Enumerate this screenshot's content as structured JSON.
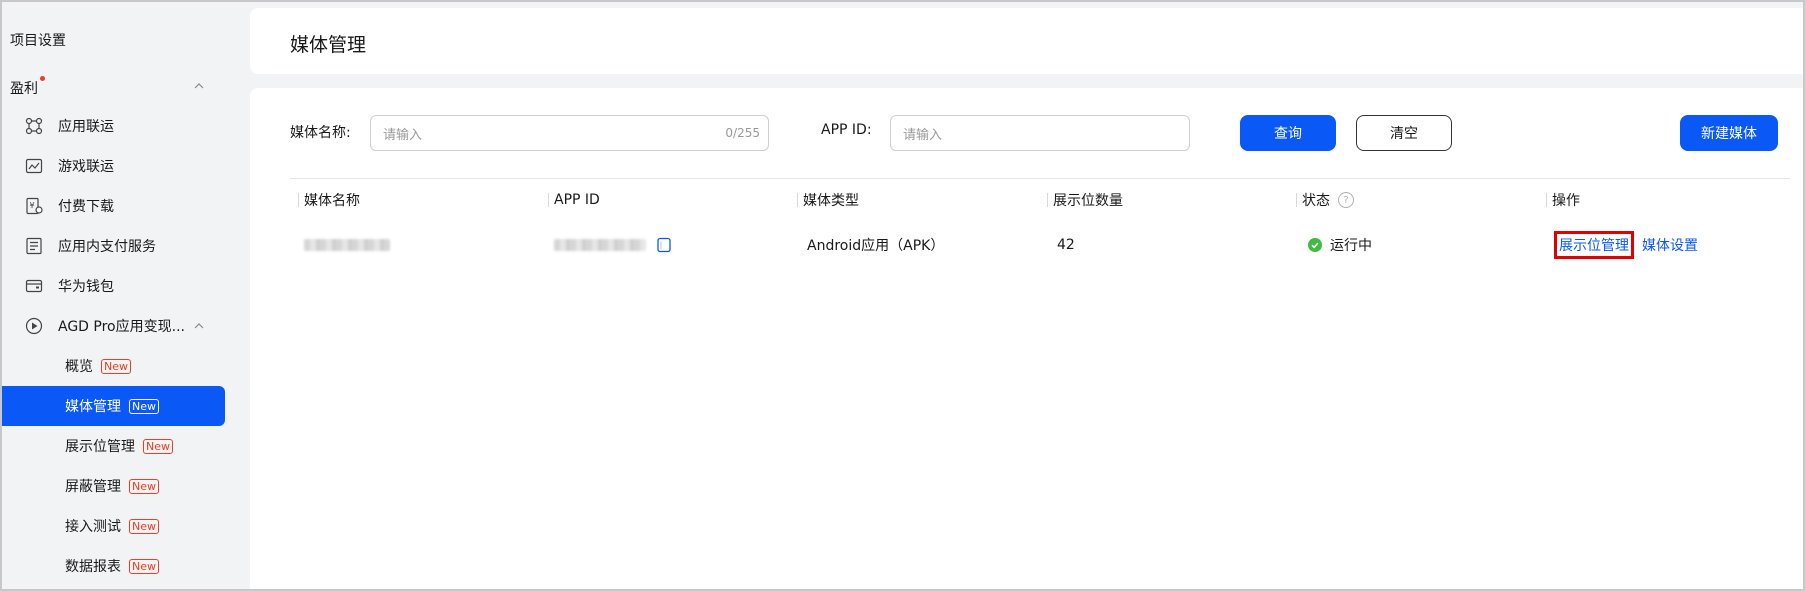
{
  "sidebar": {
    "title": "项目设置",
    "group": "盈利",
    "items": [
      {
        "label": "应用联运",
        "icon": "app-network-icon"
      },
      {
        "label": "游戏联运",
        "icon": "game-network-icon"
      },
      {
        "label": "付费下载",
        "icon": "paid-download-icon"
      },
      {
        "label": "应用内支付服务",
        "icon": "in-app-payment-icon"
      },
      {
        "label": "华为钱包",
        "icon": "wallet-icon"
      },
      {
        "label": "AGD Pro应用变现...",
        "icon": "play-circle-icon"
      }
    ],
    "subitems": [
      {
        "label": "概览",
        "badge": "New",
        "active": false
      },
      {
        "label": "媒体管理",
        "badge": "New",
        "active": true
      },
      {
        "label": "展示位管理",
        "badge": "New",
        "active": false
      },
      {
        "label": "屏蔽管理",
        "badge": "New",
        "active": false
      },
      {
        "label": "接入测试",
        "badge": "New",
        "active": false
      },
      {
        "label": "数据报表",
        "badge": "New",
        "active": false
      }
    ]
  },
  "header": {
    "title": "媒体管理"
  },
  "filters": {
    "media_name_label": "媒体名称:",
    "media_name_placeholder": "请输入",
    "media_name_counter": "0/255",
    "app_id_label": "APP ID:",
    "app_id_placeholder": "请输入",
    "query_button": "查询",
    "clear_button": "清空",
    "new_media_button": "新建媒体"
  },
  "table": {
    "columns": [
      "媒体名称",
      "APP ID",
      "媒体类型",
      "展示位数量",
      "状态",
      "操作"
    ],
    "rows": [
      {
        "media_type": "Android应用（APK）",
        "slot_count": "42",
        "status": "运行中",
        "actions": [
          "展示位管理",
          "媒体设置"
        ]
      }
    ]
  },
  "colors": {
    "accent": "#0a59f7",
    "badge": "#e84026",
    "status_ok": "#41ba41",
    "highlight": "#e00000"
  }
}
